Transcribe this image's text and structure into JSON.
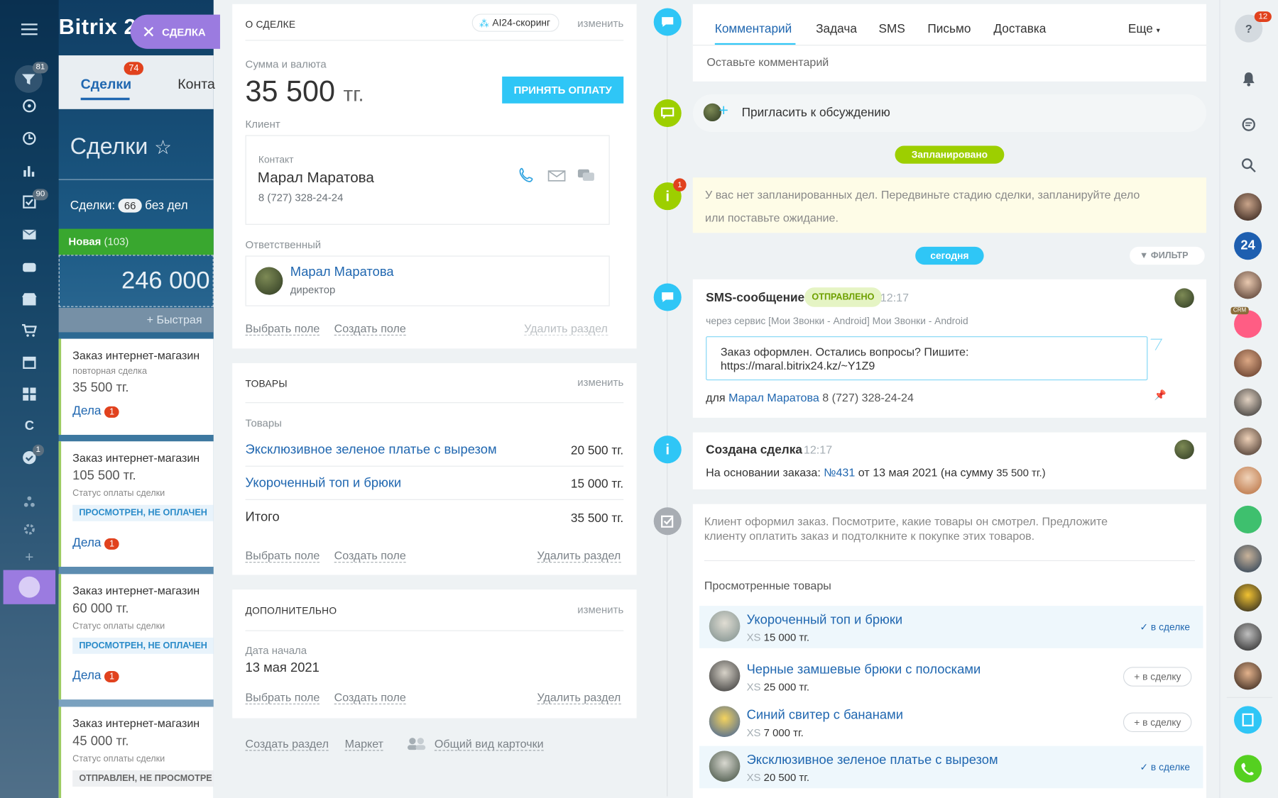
{
  "left": {
    "logo": "Bitrix 2",
    "close_label": "СДЕЛКА",
    "badges": {
      "b1": "81",
      "b2": "90",
      "b3": "1"
    },
    "tabs": [
      "Сделки",
      "Конта"
    ],
    "tab_badge": "74",
    "title": "Сделки",
    "count_label": "Сделки:",
    "count_value": "66",
    "count_suffix": "без дел",
    "column_name": "Новая",
    "column_count": "(103)",
    "column_sum": "246 000",
    "quick_add": "+ Быстрая",
    "cards": [
      {
        "title": "Заказ интернет-магазин",
        "sub": "повторная сделка",
        "value": "35 500 тг.",
        "status": "",
        "deals": "Дела",
        "badge": "1"
      },
      {
        "title": "Заказ интернет-магазин",
        "value": "105 500 тг.",
        "sub": "Статус оплаты сделки",
        "status": "ПРОСМОТРЕН, НЕ ОПЛАЧЕН",
        "deals": "Дела",
        "badge": "1"
      },
      {
        "title": "Заказ интернет-магазин",
        "value": "60 000 тг.",
        "sub": "Статус оплаты сделки",
        "status": "ПРОСМОТРЕН, НЕ ОПЛАЧЕН",
        "deals": "Дела",
        "badge": "1"
      },
      {
        "title": "Заказ интернет-магазин",
        "value": "45 000 тг.",
        "sub": "Статус оплаты сделки",
        "status": "ОТПРАВЛЕН, НЕ ПРОСМОТРЕ",
        "deals": "",
        "badge": ""
      }
    ]
  },
  "about": {
    "header": "О СДЕЛКЕ",
    "ai_badge": "AI24-скоринг",
    "edit": "изменить",
    "amount_label": "Сумма и валюта",
    "amount": "35 500",
    "currency": "тг.",
    "pay_button": "ПРИНЯТЬ ОПЛАТУ",
    "client_label": "Клиент",
    "contact_label": "Контакт",
    "contact_name": "Марал Маратова",
    "contact_phone": "8 (727) 328-24-24",
    "responsible_label": "Ответственный",
    "responsible_name": "Марал Маратова",
    "responsible_role": "директор",
    "select_field": "Выбрать поле",
    "create_field": "Создать поле",
    "delete_section": "Удалить раздел"
  },
  "goods": {
    "header": "ТОВАРЫ",
    "edit": "изменить",
    "label": "Товары",
    "items": [
      {
        "name": "Эксклюзивное зеленое платье с вырезом",
        "price": "20 500 тг."
      },
      {
        "name": "Укороченный топ и брюки",
        "price": "15 000 тг."
      }
    ],
    "total_label": "Итого",
    "total": "35 500 тг.",
    "select_field": "Выбрать поле",
    "create_field": "Создать поле",
    "delete_section": "Удалить раздел"
  },
  "extra": {
    "header": "ДОПОЛНИТЕЛЬНО",
    "edit": "изменить",
    "date_label": "Дата начала",
    "date": "13 мая 2021",
    "select_field": "Выбрать поле",
    "create_field": "Создать поле",
    "delete_section": "Удалить раздел"
  },
  "footer": {
    "create_section": "Создать раздел",
    "market": "Маркет",
    "common_view": "Общий вид карточки"
  },
  "timeline": {
    "tabs": [
      "Комментарий",
      "Задача",
      "SMS",
      "Письмо",
      "Доставка"
    ],
    "more": "Еще",
    "comment_placeholder": "Оставьте комментарий",
    "invite": "Пригласить к обсуждению",
    "planned": "Запланировано",
    "planned_badge": "1",
    "planned_text_1": "У вас нет запланированных дел. Передвиньте стадию сделки, запланируйте дело",
    "planned_text_2": "или поставьте ожидание.",
    "today": "сегодня",
    "filter": "ФИЛЬТР",
    "sms": {
      "title": "SMS-сообщение",
      "status": "ОТПРАВЛЕНО",
      "time": "12:17",
      "via": "через сервис [Мои Звонки - Android] Мои Звонки - Android",
      "text_1": "Заказ оформлен. Остались вопросы? Пишите:",
      "text_2": "https://maral.bitrix24.kz/~Y1Z9",
      "for": "для",
      "for_name": "Марал Маратова",
      "for_phone": "8 (727) 328-24-24"
    },
    "created": {
      "title": "Создана сделка",
      "time": "12:17",
      "text_before": "На основании заказа:",
      "order_link": "№431",
      "text_after": "от 13 мая 2021 (на сумму",
      "sum": "35 500 тг.)"
    },
    "client_order": {
      "text_1": "Клиент оформил заказ. Посмотрите, какие товары он смотрел. Предложите",
      "text_2": "клиенту оплатить заказ и подтолкните к покупке этих товаров.",
      "viewed_label": "Просмотренные товары",
      "items": [
        {
          "name": "Укороченный топ и брюки",
          "size": "XS",
          "price": "15 000 тг.",
          "action": "✓ в сделке"
        },
        {
          "name": "Черные замшевые брюки с полосками",
          "size": "XS",
          "price": "25 000 тг.",
          "action": "+ в сделку"
        },
        {
          "name": "Синий свитер с бананами",
          "size": "XS",
          "price": "7 000 тг.",
          "action": "+ в сделку"
        },
        {
          "name": "Эксклюзивное зеленое платье с вырезом",
          "size": "XS",
          "price": "20 500 тг.",
          "action": "✓ в сделке"
        }
      ]
    }
  },
  "right": {
    "help_badge": "12",
    "avatar_24": "24",
    "crm": "CRM"
  },
  "colors": {
    "accent": "#2fc6f6",
    "link": "#2067b0",
    "green": "#9dcf00",
    "purple": "#9b7be0"
  }
}
